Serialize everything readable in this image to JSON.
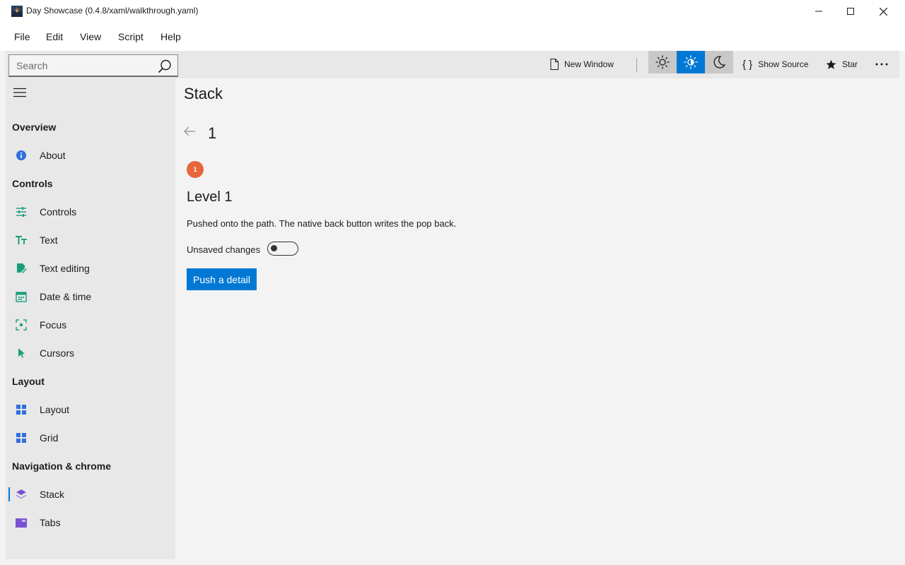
{
  "window": {
    "title": "Day Showcase (0.4.8/xaml/walkthrough.yaml)"
  },
  "menu": [
    "File",
    "Edit",
    "View",
    "Script",
    "Help"
  ],
  "toolbar": {
    "search_placeholder": "Search",
    "new_window": "New Window",
    "show_source": "Show Source",
    "star": "Star",
    "theme_selected": "auto"
  },
  "sidebar": {
    "sections": [
      {
        "title": "Overview",
        "items": [
          {
            "label": "About",
            "icon": "info-icon",
            "color": "#2f6fde"
          }
        ]
      },
      {
        "title": "Controls",
        "items": [
          {
            "label": "Controls",
            "icon": "sliders-icon",
            "color": "#1a9e7a"
          },
          {
            "label": "Text",
            "icon": "text-icon",
            "color": "#1a9e7a"
          },
          {
            "label": "Text editing",
            "icon": "edit-icon",
            "color": "#1a9e7a"
          },
          {
            "label": "Date & time",
            "icon": "calendar-icon",
            "color": "#1a9e7a"
          },
          {
            "label": "Focus",
            "icon": "focus-icon",
            "color": "#1a9e7a"
          },
          {
            "label": "Cursors",
            "icon": "cursor-icon",
            "color": "#1a9e7a"
          }
        ]
      },
      {
        "title": "Layout",
        "items": [
          {
            "label": "Layout",
            "icon": "layout-icon",
            "color": "#2f6fde"
          },
          {
            "label": "Grid",
            "icon": "grid-icon",
            "color": "#2f6fde"
          }
        ]
      },
      {
        "title": "Navigation & chrome",
        "items": [
          {
            "label": "Stack",
            "icon": "stack-icon",
            "color": "#7a52d1",
            "selected": true
          },
          {
            "label": "Tabs",
            "icon": "tabs-icon",
            "color": "#7a52d1"
          }
        ]
      }
    ]
  },
  "content": {
    "page_title": "Stack",
    "crumb": "1",
    "level_badge": "1",
    "level_title": "Level 1",
    "level_desc": "Pushed onto the path. The native back button writes the pop back.",
    "toggle_label": "Unsaved changes",
    "toggle_on": false,
    "push_button": "Push a detail"
  },
  "colors": {
    "accent": "#0078d4",
    "badge": "#e8663c"
  }
}
